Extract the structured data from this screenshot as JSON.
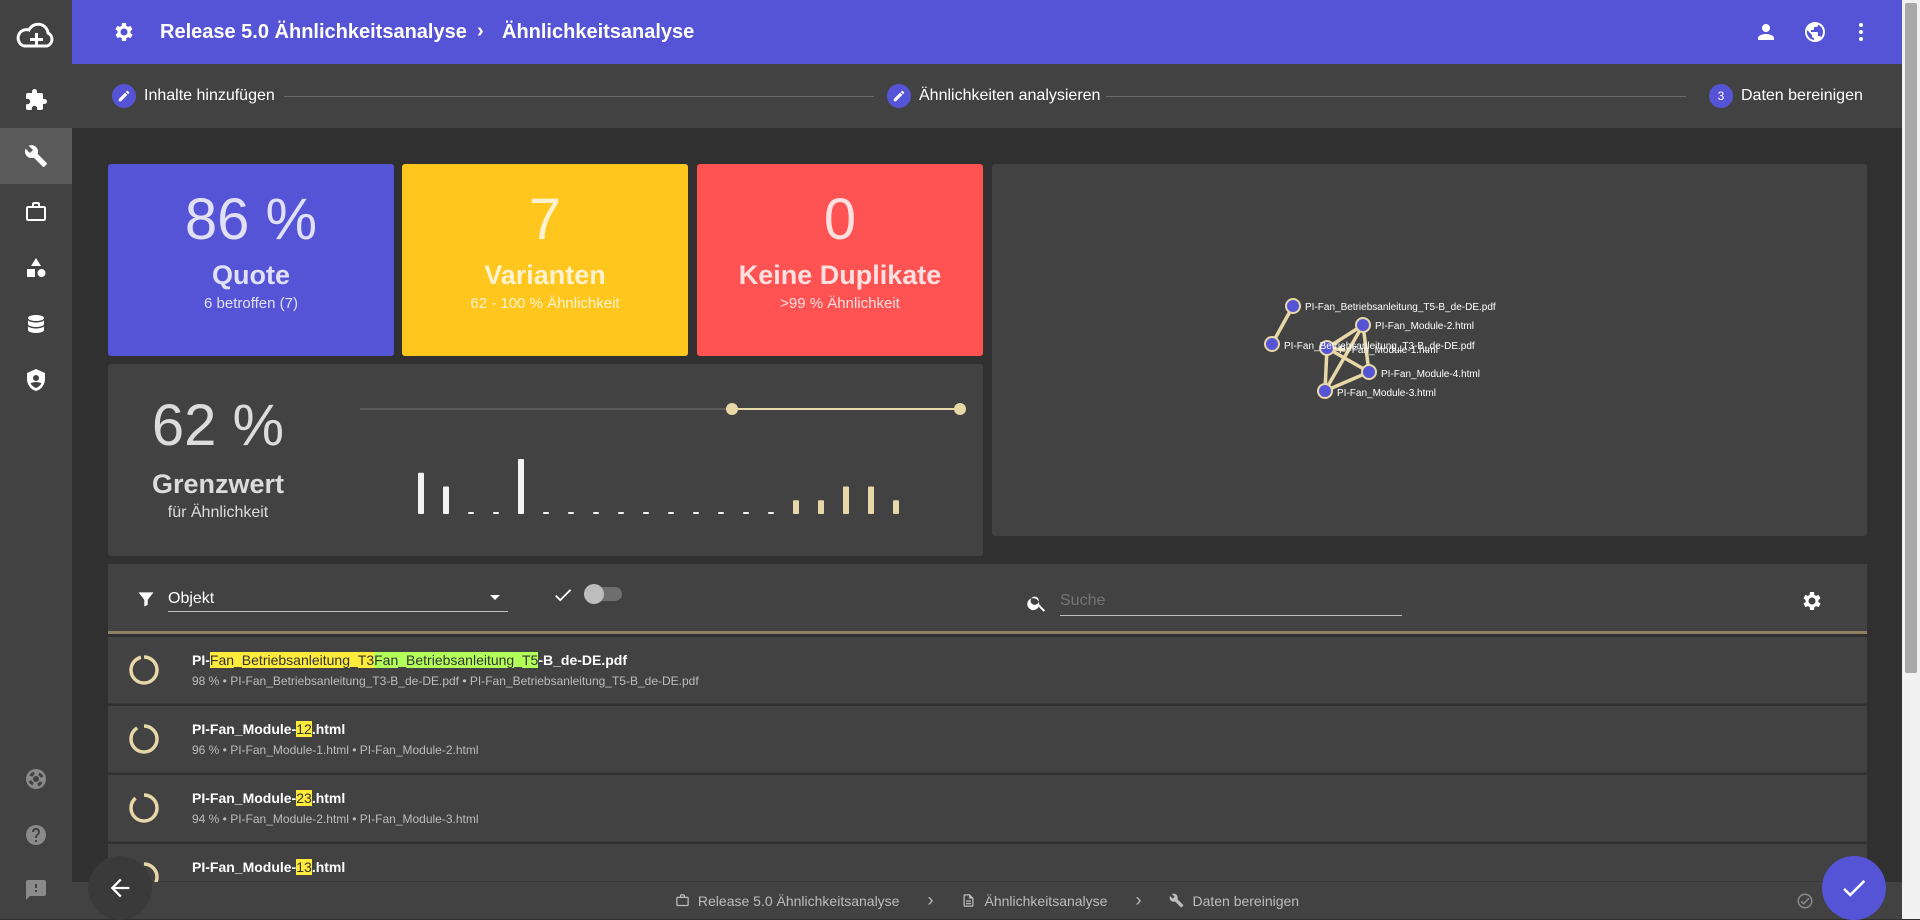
{
  "app": {
    "breadcrumb_root": "Release 5.0 Ähnlichkeitsanalyse",
    "breadcrumb_current": "Ähnlichkeitsanalyse"
  },
  "nav_icons": [
    "cloud-add-icon",
    "puzzle-icon",
    "wrench-icon",
    "briefcase-icon",
    "shapes-icon",
    "database-icon",
    "shield-icon",
    "lifebuoy-icon",
    "help-icon",
    "feedback-icon"
  ],
  "stepper": {
    "step1": "Inhalte hinzufügen",
    "step2": "Ähnlichkeiten analysieren",
    "step3_number": "3",
    "step3": "Daten bereinigen"
  },
  "tiles": {
    "quote": {
      "value": "86 %",
      "label": "Quote",
      "sub": "6 betroffen (7)",
      "color": "#5654d6"
    },
    "varianten": {
      "value": "7",
      "label": "Varianten",
      "sub": "62 - 100 % Ähnlichkeit",
      "color": "#ffc61e"
    },
    "duplikate": {
      "value": "0",
      "label": "Keine Duplikate",
      "sub": ">99 % Ähnlichkeit",
      "color": "#ff5252"
    }
  },
  "threshold": {
    "value": "62 %",
    "label": "Grenzwert",
    "sub": "für Ähnlichkeit",
    "slider_range": [
      0.62,
      1.0
    ],
    "histogram": [
      3,
      2,
      0,
      0,
      4,
      0,
      0,
      0,
      0,
      0,
      0,
      0,
      0,
      0,
      0,
      1,
      1,
      2,
      2,
      1
    ]
  },
  "graph": {
    "nodes": [
      "PI-Fan_Betriebsanleitung_T5-B_de-DE.pdf",
      "PI-Fan_Betriebsanleitung_T3-B_de-DE.pdf",
      "PI-Fan_Module-2.html",
      "PI-Fan_Module-1.html",
      "PI-Fan_Module-4.html",
      "PI-Fan_Module-3.html"
    ]
  },
  "filter": {
    "object_label": "Objekt",
    "search_placeholder": "Suche"
  },
  "results": [
    {
      "pre": "PI-",
      "hl1": "Fan_Betriebsanleitung_T3",
      "hl2": "Fan_Betriebsanleitung_T5",
      "post": "-B_de-DE.pdf",
      "meta": "98 % • PI-Fan_Betriebsanleitung_T3-B_de-DE.pdf • PI-Fan_Betriebsanleitung_T5-B_de-DE.pdf"
    },
    {
      "pre": "PI-Fan_Module-",
      "hl1": "12",
      "post": ".html",
      "meta": "96 % • PI-Fan_Module-1.html • PI-Fan_Module-2.html"
    },
    {
      "pre": "PI-Fan_Module-",
      "hl1": "23",
      "post": ".html",
      "meta": "94 % • PI-Fan_Module-2.html • PI-Fan_Module-3.html"
    },
    {
      "pre": "PI-Fan_Module-",
      "hl1": "13",
      "post": ".html",
      "meta": ""
    }
  ],
  "footer": {
    "crumb1": "Release 5.0 Ähnlichkeitsanalyse",
    "crumb2": "Ähnlichkeitsanalyse",
    "crumb3": "Daten bereinigen"
  }
}
